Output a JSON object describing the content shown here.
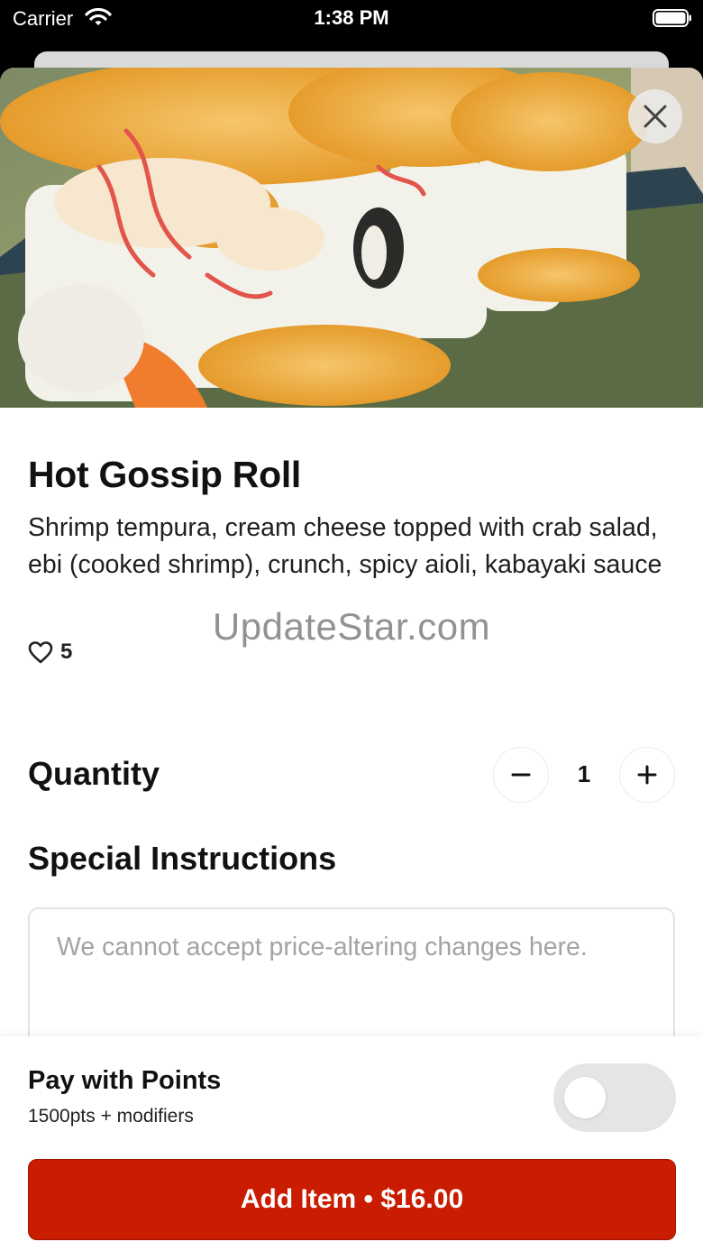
{
  "status_bar": {
    "carrier": "Carrier",
    "time": "1:38 PM"
  },
  "item": {
    "title": "Hot Gossip Roll",
    "description": "Shrimp tempura, cream cheese topped with crab salad, ebi (cooked shrimp), crunch, spicy aioli, kabayaki sauce",
    "likes": "5"
  },
  "watermark": "UpdateStar.com",
  "quantity": {
    "label": "Quantity",
    "value": "1"
  },
  "special_instructions": {
    "label": "Special Instructions",
    "placeholder": "We cannot accept price-altering changes here."
  },
  "pay_with_points": {
    "title": "Pay with Points",
    "subtitle": "1500pts + modifiers",
    "enabled": false
  },
  "add_button": {
    "label": "Add Item • $16.00"
  },
  "icons": [
    "wifi-icon",
    "battery-icon",
    "close-icon",
    "heart-icon",
    "minus-icon",
    "plus-icon"
  ],
  "colors": {
    "accent": "#c91c00",
    "toggle_off": "#e5e5e5"
  }
}
